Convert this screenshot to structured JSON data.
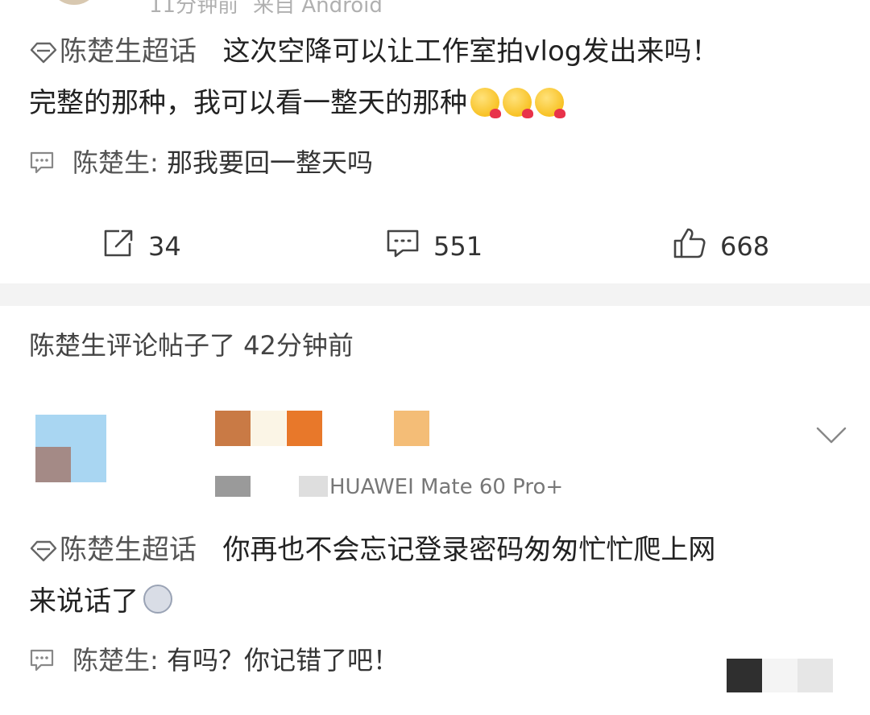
{
  "top_peek": {
    "time": "11分钟前",
    "source": "来自 Android"
  },
  "post1": {
    "topic": "陈楚生超话",
    "text_line1": "这次空降可以让工作室拍vlog发出来吗！",
    "text_line2": "完整的那种，我可以看一整天的那种",
    "reply_name": "陈楚生:",
    "reply_text": "那我要回一整天吗"
  },
  "actions": {
    "share_count": "34",
    "comment_count": "551",
    "like_count": "668"
  },
  "activity": {
    "text": "陈楚生评论帖子了 42分钟前"
  },
  "post2": {
    "device": "HUAWEI Mate 60 Pro+",
    "topic": "陈楚生超话",
    "text_line1": "你再也不会忘记登录密码匆匆忙忙爬上网",
    "text_line2": "来说话了",
    "reply_name": "陈楚生:",
    "reply_text": "有吗？你记错了吧！"
  },
  "colors": {
    "accent_pixel_1": "#c97a45",
    "accent_pixel_2": "#e8782a",
    "accent_pixel_3": "#f4bd77",
    "divider": "#f3f3f3"
  },
  "icons": [
    "topic-diamond-icon",
    "reply-comment-icon",
    "share-icon",
    "comment-icon",
    "like-icon",
    "chevron-down-icon"
  ]
}
